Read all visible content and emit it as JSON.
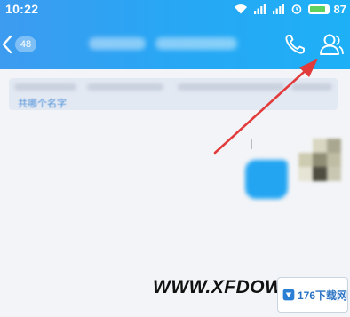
{
  "status_bar": {
    "time": "10:22",
    "battery_level": "87",
    "battery_fraction": 0.87,
    "icons": [
      "wifi-icon",
      "signal-icon",
      "signal-icon",
      "alarm-icon",
      "battery-icon"
    ]
  },
  "title_bar": {
    "back_icon": "chevron-left-icon",
    "unread_count": "48",
    "call_icon": "phone-icon",
    "profile_icon": "group-members-icon",
    "colors": {
      "bar_start": "#3d9bf0",
      "bar_end": "#1eb0f6"
    }
  },
  "notice": {
    "link_text": "共哪个名字"
  },
  "chat": {
    "bubble_color": "#23a5f2"
  },
  "annotation": {
    "color": "#e23b3b",
    "points_to": "profile-button"
  },
  "watermark": {
    "text": "WWW.XFDOW",
    "badge_text": "176下载网"
  }
}
